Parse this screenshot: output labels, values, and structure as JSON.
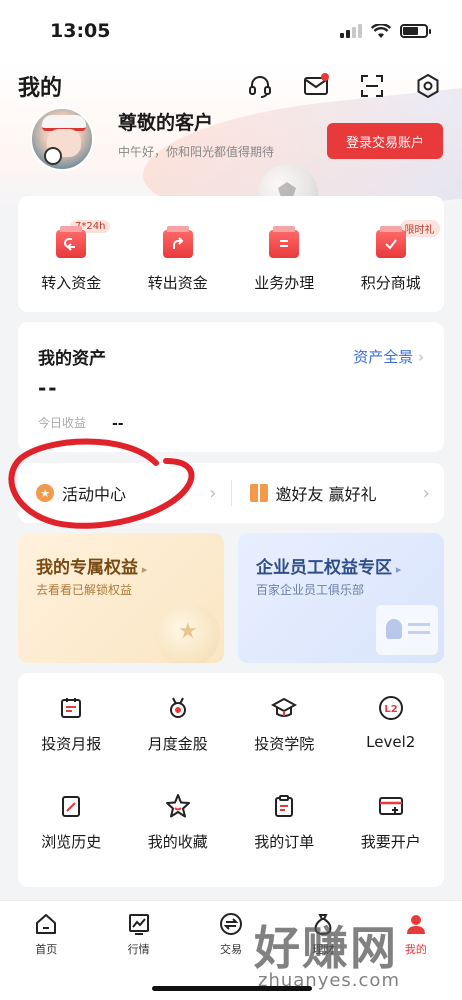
{
  "status_bar": {
    "time": "13:05"
  },
  "header": {
    "title": "我的"
  },
  "profile": {
    "name": "尊敬的客户",
    "greeting": "中午好，你和阳光都值得期待",
    "login_button": "登录交易账户"
  },
  "quick_actions": [
    {
      "label": "转入资金",
      "badge": "7*24h",
      "icon": "transfer-in-icon"
    },
    {
      "label": "转出资金",
      "badge": "",
      "icon": "transfer-out-icon"
    },
    {
      "label": "业务办理",
      "badge": "",
      "icon": "business-icon"
    },
    {
      "label": "积分商城",
      "badge": "限时礼",
      "icon": "points-mall-icon"
    }
  ],
  "assets": {
    "title": "我的资产",
    "overview_link": "资产全景",
    "total_value": "--",
    "profit_label": "今日收益",
    "profit_value": "--"
  },
  "activities": {
    "left_label": "活动中心",
    "right_label": "邀好友 赢好礼"
  },
  "promos": [
    {
      "title": "我的专属权益",
      "subtitle": "去看看已解锁权益"
    },
    {
      "title": "企业员工权益专区",
      "subtitle": "百家企业员工俱乐部"
    }
  ],
  "tools": [
    {
      "label": "投资月报",
      "icon": "calendar-report-icon"
    },
    {
      "label": "月度金股",
      "icon": "medal-icon"
    },
    {
      "label": "投资学院",
      "icon": "graduation-cap-icon"
    },
    {
      "label": "Level2",
      "icon": "level2-icon"
    },
    {
      "label": "浏览历史",
      "icon": "history-icon"
    },
    {
      "label": "我的收藏",
      "icon": "star-icon"
    },
    {
      "label": "我的订单",
      "icon": "clipboard-icon"
    },
    {
      "label": "我要开户",
      "icon": "open-account-icon"
    }
  ],
  "tabbar": [
    {
      "label": "首页",
      "icon": "home-icon",
      "active": false
    },
    {
      "label": "行情",
      "icon": "market-chart-icon",
      "active": false
    },
    {
      "label": "交易",
      "icon": "trade-icon",
      "active": false
    },
    {
      "label": "理财",
      "icon": "wealth-icon",
      "active": false
    },
    {
      "label": "我的",
      "icon": "profile-icon",
      "active": true
    }
  ],
  "watermark": {
    "main": "好赚网",
    "sub": "zhuanyes.com"
  },
  "colors": {
    "accent": "#e8393b",
    "link": "#3a6fd8",
    "annotation": "#e0232a"
  }
}
